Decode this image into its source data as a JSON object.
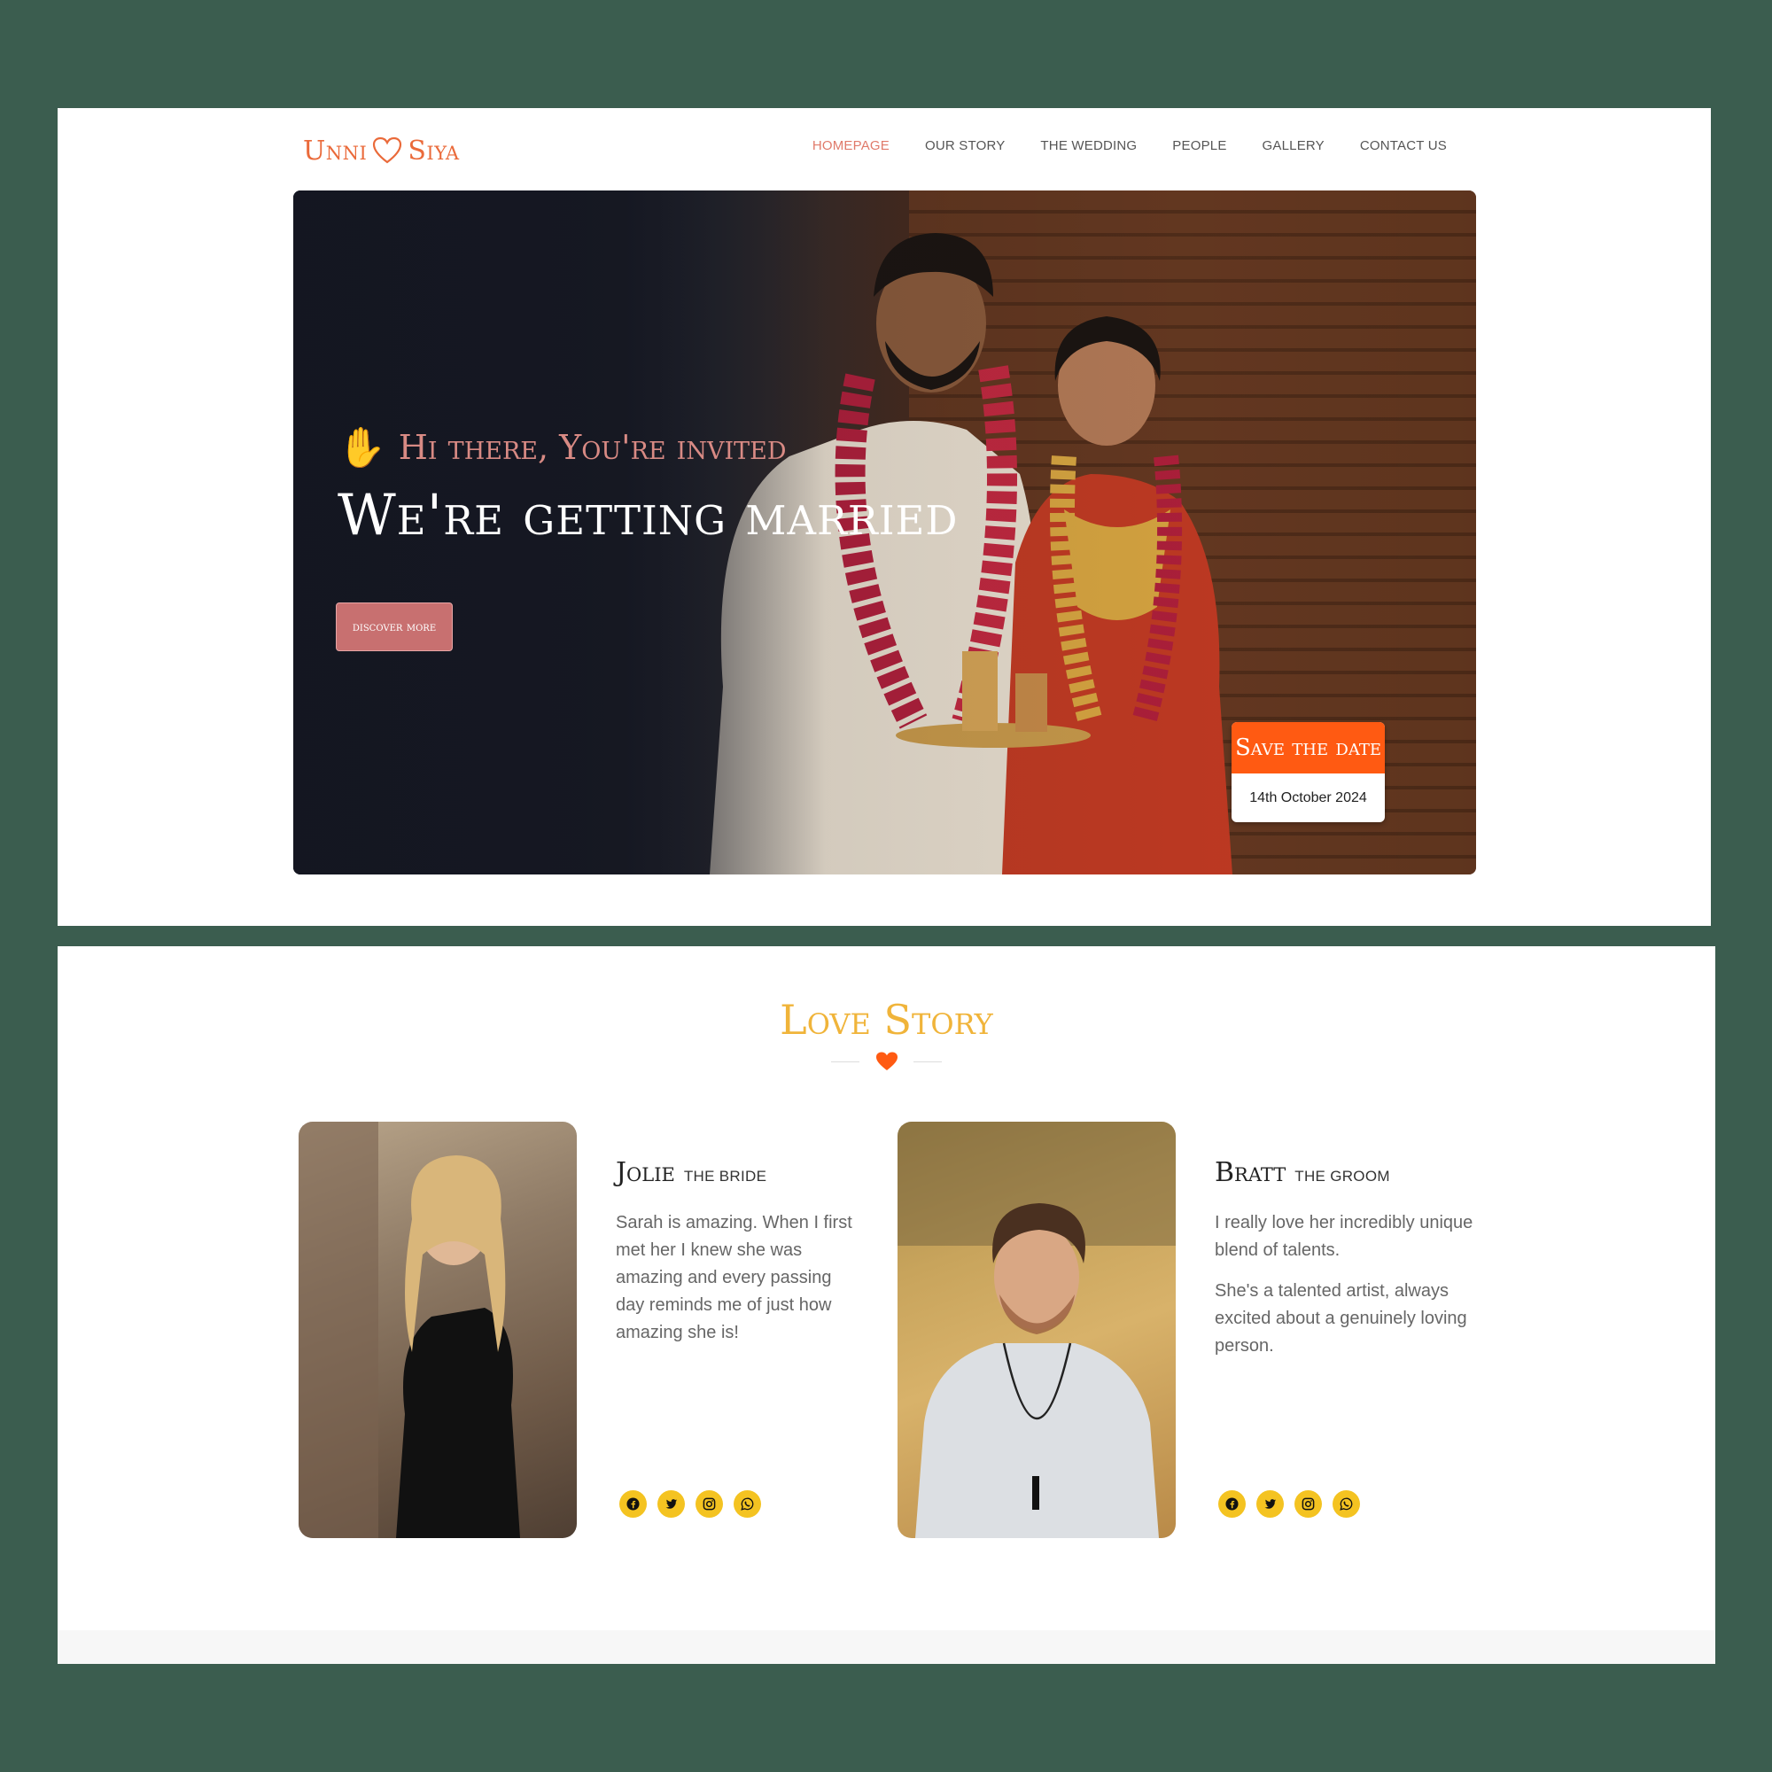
{
  "brand": {
    "name_left": "Unni",
    "name_right": "Siya",
    "accent": "#ea6a3a"
  },
  "nav": [
    {
      "label": "HOMEPAGE",
      "active": true
    },
    {
      "label": "OUR STORY"
    },
    {
      "label": "THE WEDDING"
    },
    {
      "label": "PEOPLE"
    },
    {
      "label": "GALLERY"
    },
    {
      "label": "CONTACT US"
    }
  ],
  "hero": {
    "greeting": "Hi there, You're invited",
    "headline": "We're getting married",
    "cta": "discover more",
    "save_the_date": {
      "title": "Save the date",
      "date": "14th October 2024"
    }
  },
  "love_story": {
    "title": "Love Story",
    "bride": {
      "name": "Jolie",
      "role": "THE BRIDE",
      "bio": [
        "Sarah is amazing. When I first met her I knew she was amazing and every passing day reminds me of just how amazing she is!"
      ]
    },
    "groom": {
      "name": "Bratt",
      "role": "THE GROOM",
      "bio": [
        "I really love her incredibly unique blend of talents.",
        "She's a talented artist, always excited about a genuinely loving person."
      ]
    },
    "social_icons": [
      "facebook-icon",
      "twitter-icon",
      "instagram-icon",
      "whatsapp-icon"
    ]
  },
  "colors": {
    "background": "#3b5d4f",
    "orange": "#ff5a12",
    "gold": "#f4c321",
    "rose": "#c87070"
  }
}
